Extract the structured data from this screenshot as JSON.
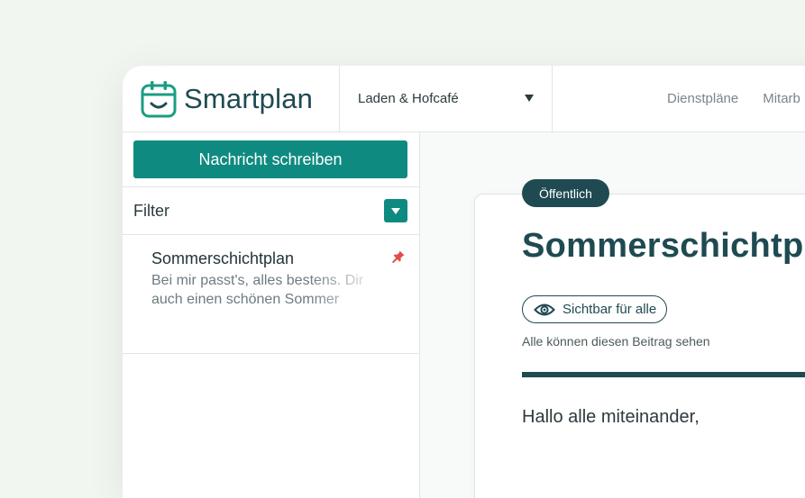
{
  "app": {
    "brand_name": "Smartplan",
    "brand_color": "#1f4a52",
    "accent_color": "#0f8a80"
  },
  "header": {
    "location": "Laden & Hofcafé",
    "location_caret_icon": "caret-down-icon",
    "nav": [
      {
        "label": "Dienstpläne"
      },
      {
        "label": "Mitarb"
      }
    ]
  },
  "sidebar": {
    "compose_label": "Nachricht schreiben",
    "filter_label": "Filter",
    "filter_icon": "caret-down-icon",
    "messages": [
      {
        "title": "Sommerschichtplan",
        "preview": "Bei mir passt's, alles bestens. Dir auch einen schönen Sommer",
        "pin_icon": "pin-icon"
      }
    ]
  },
  "post": {
    "badge": "Öffentlich",
    "title": "Sommerschichtplan",
    "visibility_label": "Sichtbar für alle",
    "visibility_icon": "eye-icon",
    "visibility_description": "Alle können diesen Beitrag sehen",
    "body": "Hallo alle miteinander,"
  }
}
